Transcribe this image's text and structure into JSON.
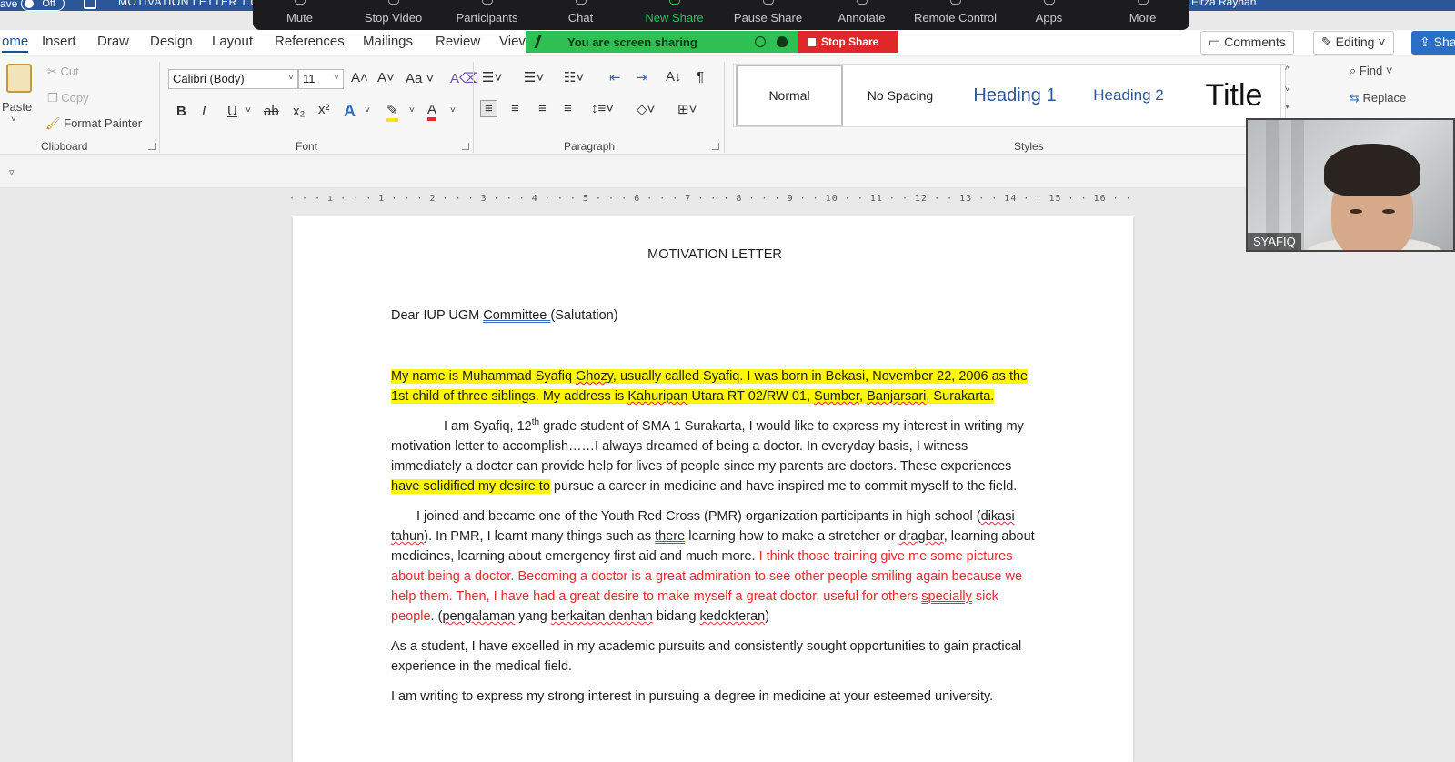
{
  "titlebar": {
    "autosave_label": "ave",
    "autosave_state": "Off",
    "doc_title": "MOTIVATION LETTER 1.0",
    "user_name": "Firza Rayhan"
  },
  "zoom": {
    "items": [
      {
        "label": "Mute",
        "icon": "microphone-icon"
      },
      {
        "label": "Stop Video",
        "icon": "video-camera-icon"
      },
      {
        "label": "Participants",
        "icon": "participants-icon"
      },
      {
        "label": "Chat",
        "icon": "chat-icon"
      },
      {
        "label": "New Share",
        "icon": "share-screen-icon"
      },
      {
        "label": "Pause Share",
        "icon": "pause-icon"
      },
      {
        "label": "Annotate",
        "icon": "pen-icon"
      },
      {
        "label": "Remote Control",
        "icon": "mouse-icon"
      },
      {
        "label": "Apps",
        "icon": "apps-icon"
      },
      {
        "label": "More",
        "icon": "more-icon"
      }
    ],
    "sharing_text": "You are screen sharing",
    "stop_share_label": "Stop Share",
    "active_color": "#22c55e",
    "stop_color": "#e02828"
  },
  "tabs": {
    "items": [
      "ome",
      "Insert",
      "Draw",
      "Design",
      "Layout",
      "References",
      "Mailings",
      "Review",
      "Viev"
    ],
    "comments_label": "Comments",
    "editing_label": "Editing",
    "share_label": "Sha"
  },
  "ribbon": {
    "clipboard": {
      "paste": "Paste",
      "cut": "Cut",
      "copy": "Copy",
      "format_painter": "Format Painter",
      "group": "Clipboard"
    },
    "font": {
      "family": "Calibri (Body)",
      "size": "11",
      "group": "Font",
      "change_case": "Aa"
    },
    "paragraph": {
      "group": "Paragraph"
    },
    "styles": {
      "items": [
        {
          "label": "Normal"
        },
        {
          "label": "No Spacing"
        },
        {
          "label": "Heading 1"
        },
        {
          "label": "Heading 2"
        },
        {
          "label": "Title"
        }
      ],
      "group": "Styles"
    },
    "editing": {
      "find": "Find",
      "replace": "Replace"
    }
  },
  "ruler": {
    "scale": "· · · ı · · · 1 · · · 2 · · · 3 · · · 4 · · · 5 · · · 6 · · · 7 · · · 8 · · · 9 · · 10 · · 11 · · 12 · · 13 · · 14 · · 15 · · 16 · · · ı · · ·"
  },
  "document": {
    "title": "MOTIVATION LETTER",
    "salutation": {
      "pre": "Dear IUP UGM ",
      "committee": "Committee ",
      "post": " (Salutation)"
    },
    "p1": {
      "a": "My name is Muhammad Syafiq ",
      "ghozy": "Ghozy",
      "b": ", usually called Syafiq. I was born in Bekasi, November 22, 2006 as the 1st child of three siblings. My address is ",
      "kahuripan": "Kahuripan",
      "c": " Utara RT 02/RW 01, ",
      "sumber": "Sumber",
      "d": ", ",
      "banjarsari": "Banjarsari",
      "e": ", Surakarta."
    },
    "p2": {
      "a": "I am Syafiq, 12",
      "sup": "th",
      "b": " grade student of SMA 1 Surakarta, I would like to express my interest in writing my motivation letter to accomplish……I always dreamed of being a doctor. In everyday basis, I witness immediately a doctor can provide help for lives of people since my parents are doctors. These experiences ",
      "hl": "have solidified my desire to",
      "c": " pursue a career in medicine and have inspired me to commit myself to the field."
    },
    "p3": {
      "a": "I joined and became one of the Youth Red Cross (PMR) organization participants in high school (",
      "dikasi": "dikasi tahun",
      "b": "). In PMR, I learnt many things such as ",
      "there": "there",
      "c": " learning how to make a stretcher or ",
      "dragbar": "dragbar",
      "d": ", learning about medicines, learning about emergency first aid and much more. ",
      "red1": "I think those training give me some pictures about being a doctor. Becoming a doctor is a great admiration to see other people smiling again because we help them. Then, I have had a great desire to make myself a great doctor, useful for others ",
      "specially": "specially",
      "red2": " sick people",
      "e": ". (",
      "pengalaman": "pengalaman",
      "f": " yang ",
      "berkaitan": "berkaitan denhan",
      "g": " bidang ",
      "kedokteran": "kedokteran",
      "h": ")"
    },
    "p4": "As a student, I have excelled in my academic pursuits and consistently sought opportunities to gain practical experience in the medical field.",
    "p5": "I am writing to express my strong interest in pursuing a degree in medicine at your esteemed university."
  },
  "video": {
    "name": "SYAFIQ"
  }
}
